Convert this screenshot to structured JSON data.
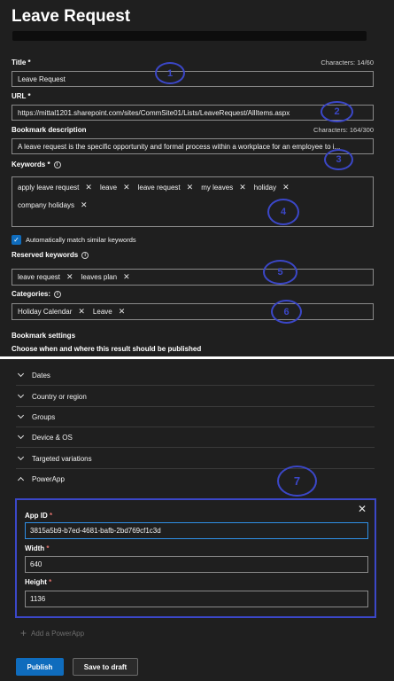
{
  "header": {
    "title": "Leave Request"
  },
  "title_field": {
    "label": "Title *",
    "counter": "Characters: 14/60",
    "value": "Leave Request"
  },
  "url_field": {
    "label": "URL *",
    "value": "https://mittal1201.sharepoint.com/sites/CommSite01/Lists/LeaveRequest/AllItems.aspx"
  },
  "description": {
    "label": "Bookmark description",
    "counter": "Characters: 164/300",
    "value": "A leave request is the specific opportunity and formal process within a workplace for an employee to i..."
  },
  "keywords": {
    "label": "Keywords *",
    "tags": [
      "apply leave request",
      "leave",
      "leave request",
      "my leaves",
      "holiday",
      "company holidays"
    ]
  },
  "auto_match": {
    "label": "Automatically match similar keywords",
    "checked": true
  },
  "reserved": {
    "label": "Reserved keywords",
    "tags": [
      "leave request",
      "leaves plan"
    ]
  },
  "categories": {
    "label": "Categories:",
    "tags": [
      "Holiday Calendar",
      "Leave"
    ]
  },
  "bookmark_settings": {
    "label": "Bookmark settings",
    "hint": "Choose when and where this result should be published"
  },
  "sections": [
    "Dates",
    "Country or region",
    "Groups",
    "Device & OS",
    "Targeted variations",
    "PowerApp"
  ],
  "powerapp": {
    "app_id_label": "App ID",
    "app_id_value": "3815a5b9-b7ed-4681-bafb-2bd769cf1c3d",
    "width_label": "Width",
    "width_value": "640",
    "height_label": "Height",
    "height_value": "1136",
    "required_mark": "*",
    "add_label": "Add a PowerApp"
  },
  "annotations": [
    "1",
    "2",
    "3",
    "4",
    "5",
    "6",
    "7"
  ],
  "actions": {
    "publish": "Publish",
    "draft": "Save to draft"
  },
  "colors": {
    "background": "#1f1f1f",
    "accent": "#0f6cbd",
    "annotation": "#3b47c8",
    "required": "#e0716c"
  }
}
